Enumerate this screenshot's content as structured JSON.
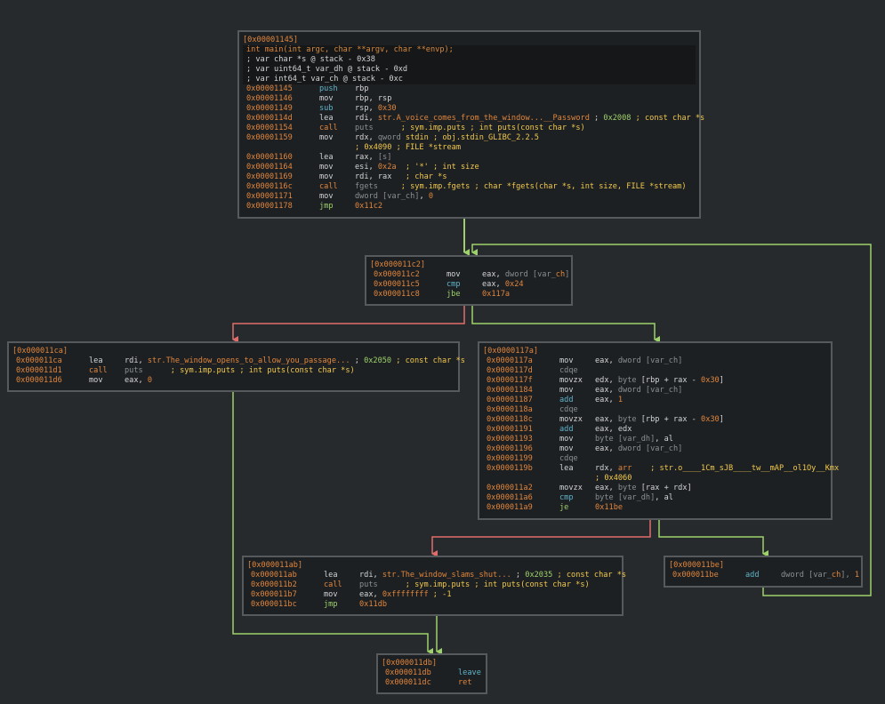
{
  "colors": {
    "background": "#262a2d",
    "node_bg": "#1d2023",
    "node_border": "#565a5d",
    "edge_true": "#9ed16b",
    "edge_false": "#e06c6c",
    "address": "#e0853c",
    "comment": "#f2c94c",
    "mnemonic_flow": "#e0853c",
    "mnemonic_cmp": "#5fb3c8"
  },
  "nodes": [
    {
      "id": "node-1145",
      "header": "[0x00001145]",
      "lines": [
        {
          "hl": true,
          "segs": [
            [
              "int ",
              "c-orange"
            ],
            [
              "main",
              "c-orange"
            ],
            [
              "(int argc, char **argv, char **envp);",
              "c-sig"
            ]
          ]
        },
        {
          "hl": true,
          "segs": [
            [
              "; var char *s @ stack - 0x38",
              "c-white"
            ]
          ]
        },
        {
          "hl": true,
          "segs": [
            [
              "; var uint64_t var_dh @ stack - 0xd",
              "c-white"
            ]
          ]
        },
        {
          "hl": true,
          "segs": [
            [
              "; var int64_t var_ch @ stack - 0xc",
              "c-white"
            ]
          ]
        },
        {
          "addr": "0x00001145",
          "mn": "push",
          "mc": "c-cyan",
          "op": [
            [
              "rbp",
              "c-white"
            ]
          ]
        },
        {
          "addr": "0x00001146",
          "mn": "mov",
          "mc": "c-white",
          "op": [
            [
              "rbp, rsp",
              "c-white"
            ]
          ]
        },
        {
          "addr": "0x00001149",
          "mn": "sub",
          "mc": "c-cyan",
          "op": [
            [
              "rsp, ",
              "c-white"
            ],
            [
              "0x30",
              "c-orange"
            ]
          ]
        },
        {
          "addr": "0x0000114d",
          "mn": "lea",
          "mc": "c-white",
          "op": [
            [
              "rdi, ",
              "c-white"
            ],
            [
              "str.A_voice_comes_from_the_window...__Password",
              "c-orange"
            ],
            [
              " ; ",
              "c-white"
            ],
            [
              "0x2008",
              "c-green"
            ],
            [
              " ; const char *s",
              "c-yellow"
            ]
          ]
        },
        {
          "addr": "0x00001154",
          "mn": "call",
          "mc": "c-orange",
          "op": [
            [
              "puts",
              "c-gray"
            ],
            [
              "      ; sym.imp.puts ; int puts(const char *s)",
              "c-yellow"
            ]
          ]
        },
        {
          "addr": "0x00001159",
          "mn": "mov",
          "mc": "c-white",
          "op": [
            [
              "rdx, ",
              "c-white"
            ],
            [
              "qword",
              "c-gray"
            ],
            [
              " stdin ; obj.stdin_GLIBC_2.2.5",
              "c-yellow"
            ]
          ]
        },
        {
          "addr": "",
          "mn": "",
          "mc": "c-white",
          "op": [
            [
              "; 0x4090 ; FILE *stream",
              "c-yellow"
            ]
          ]
        },
        {
          "addr": "0x00001160",
          "mn": "lea",
          "mc": "c-white",
          "op": [
            [
              "rax, ",
              "c-white"
            ],
            [
              "[s]",
              "c-gray"
            ]
          ]
        },
        {
          "addr": "0x00001164",
          "mn": "mov",
          "mc": "c-white",
          "op": [
            [
              "esi, ",
              "c-white"
            ],
            [
              "0x2a",
              "c-orange"
            ],
            [
              "  ; '*' ; int size",
              "c-yellow"
            ]
          ]
        },
        {
          "addr": "0x00001169",
          "mn": "mov",
          "mc": "c-white",
          "op": [
            [
              "rdi, rax",
              "c-white"
            ],
            [
              "   ; char *s",
              "c-yellow"
            ]
          ]
        },
        {
          "addr": "0x0000116c",
          "mn": "call",
          "mc": "c-orange",
          "op": [
            [
              "fgets",
              "c-gray"
            ],
            [
              "     ; sym.imp.fgets ; char *fgets(char *s, int size, FILE *stream)",
              "c-yellow"
            ]
          ]
        },
        {
          "addr": "0x00001171",
          "mn": "mov",
          "mc": "c-white",
          "op": [
            [
              "dword",
              "c-gray"
            ],
            [
              " [var_ch]",
              "c-gray"
            ],
            [
              ", ",
              "c-white"
            ],
            [
              "0",
              "c-orange"
            ]
          ]
        },
        {
          "addr": "0x00001178",
          "mn": "jmp",
          "mc": "c-green",
          "op": [
            [
              "0x11c2",
              "c-orange"
            ]
          ]
        }
      ]
    },
    {
      "id": "node-11c2",
      "header": "[0x000011c2]",
      "lines": [
        {
          "addr": "0x000011c2",
          "mn": "mov",
          "mc": "c-white",
          "op": [
            [
              "eax, ",
              "c-white"
            ],
            [
              "dword",
              "c-gray"
            ],
            [
              " [var_",
              "c-gray"
            ],
            [
              "ch",
              "c-orange"
            ],
            [
              "]",
              "c-gray"
            ]
          ]
        },
        {
          "addr": "0x000011c5",
          "mn": "cmp",
          "mc": "c-cyan",
          "op": [
            [
              "eax, ",
              "c-white"
            ],
            [
              "0x24",
              "c-orange"
            ]
          ]
        },
        {
          "addr": "0x000011c8",
          "mn": "jbe",
          "mc": "c-green",
          "op": [
            [
              "0x117a",
              "c-orange"
            ]
          ]
        }
      ]
    },
    {
      "id": "node-11ca",
      "header": "[0x000011ca]",
      "lines": [
        {
          "addr": "0x000011ca",
          "mn": "lea",
          "mc": "c-white",
          "op": [
            [
              "rdi, ",
              "c-white"
            ],
            [
              "str.The_window_opens_to_allow_you_passage...",
              "c-orange"
            ],
            [
              " ; ",
              "c-white"
            ],
            [
              "0x2050",
              "c-green"
            ],
            [
              " ; const char *s",
              "c-yellow"
            ]
          ]
        },
        {
          "addr": "0x000011d1",
          "mn": "call",
          "mc": "c-orange",
          "op": [
            [
              "puts",
              "c-gray"
            ],
            [
              "      ; sym.imp.puts ; int puts(const char *s)",
              "c-yellow"
            ]
          ]
        },
        {
          "addr": "0x000011d6",
          "mn": "mov",
          "mc": "c-white",
          "op": [
            [
              "eax, ",
              "c-white"
            ],
            [
              "0",
              "c-orange"
            ]
          ]
        }
      ]
    },
    {
      "id": "node-117a",
      "header": "[0x0000117a]",
      "lines": [
        {
          "addr": "0x0000117a",
          "mn": "mov",
          "mc": "c-white",
          "op": [
            [
              "eax, ",
              "c-white"
            ],
            [
              "dword [var_ch]",
              "c-gray"
            ]
          ]
        },
        {
          "addr": "0x0000117d",
          "mn": "cdqe",
          "mc": "c-gray",
          "op": []
        },
        {
          "addr": "0x0000117f",
          "mn": "movzx",
          "mc": "c-white",
          "op": [
            [
              "edx, ",
              "c-white"
            ],
            [
              "byte",
              "c-gray"
            ],
            [
              " [rbp + rax - ",
              "c-white"
            ],
            [
              "0x30",
              "c-orange"
            ],
            [
              "]",
              "c-white"
            ]
          ]
        },
        {
          "addr": "0x00001184",
          "mn": "mov",
          "mc": "c-white",
          "op": [
            [
              "eax, ",
              "c-white"
            ],
            [
              "dword [var_ch]",
              "c-gray"
            ]
          ]
        },
        {
          "addr": "0x00001187",
          "mn": "add",
          "mc": "c-cyan",
          "op": [
            [
              "eax, ",
              "c-white"
            ],
            [
              "1",
              "c-orange"
            ]
          ]
        },
        {
          "addr": "0x0000118a",
          "mn": "cdqe",
          "mc": "c-gray",
          "op": []
        },
        {
          "addr": "0x0000118c",
          "mn": "movzx",
          "mc": "c-white",
          "op": [
            [
              "eax, ",
              "c-white"
            ],
            [
              "byte",
              "c-gray"
            ],
            [
              " [rbp + rax - ",
              "c-white"
            ],
            [
              "0x30",
              "c-orange"
            ],
            [
              "]",
              "c-white"
            ]
          ]
        },
        {
          "addr": "0x00001191",
          "mn": "add",
          "mc": "c-cyan",
          "op": [
            [
              "eax, edx",
              "c-white"
            ]
          ]
        },
        {
          "addr": "0x00001193",
          "mn": "mov",
          "mc": "c-white",
          "op": [
            [
              "byte [var_dh]",
              "c-gray"
            ],
            [
              ", al",
              "c-white"
            ]
          ]
        },
        {
          "addr": "0x00001196",
          "mn": "mov",
          "mc": "c-white",
          "op": [
            [
              "eax, ",
              "c-white"
            ],
            [
              "dword [var_ch]",
              "c-gray"
            ]
          ]
        },
        {
          "addr": "0x00001199",
          "mn": "cdqe",
          "mc": "c-gray",
          "op": []
        },
        {
          "addr": "0x0000119b",
          "mn": "lea",
          "mc": "c-white",
          "op": [
            [
              "rdx, ",
              "c-white"
            ],
            [
              "arr",
              "c-orange"
            ],
            [
              "    ; str.o____1Cm_sJB____tw__mAP__ol1Oy__Kmx",
              "c-yellow"
            ]
          ]
        },
        {
          "addr": "",
          "mn": "",
          "mc": "c-white",
          "op": [
            [
              "; 0x4060",
              "c-yellow"
            ]
          ]
        },
        {
          "addr": "0x000011a2",
          "mn": "movzx",
          "mc": "c-white",
          "op": [
            [
              "eax, ",
              "c-white"
            ],
            [
              "byte",
              "c-gray"
            ],
            [
              " [rax + rdx]",
              "c-white"
            ]
          ]
        },
        {
          "addr": "0x000011a6",
          "mn": "cmp",
          "mc": "c-cyan",
          "op": [
            [
              "byte [var_dh]",
              "c-gray"
            ],
            [
              ", al",
              "c-white"
            ]
          ]
        },
        {
          "addr": "0x000011a9",
          "mn": "je",
          "mc": "c-green",
          "op": [
            [
              "0x11be",
              "c-orange"
            ]
          ]
        }
      ]
    },
    {
      "id": "node-11ab",
      "header": "[0x000011ab]",
      "lines": [
        {
          "addr": "0x000011ab",
          "mn": "lea",
          "mc": "c-white",
          "op": [
            [
              "rdi, ",
              "c-white"
            ],
            [
              "str.The_window_slams_shut...",
              "c-orange"
            ],
            [
              " ; ",
              "c-white"
            ],
            [
              "0x2035",
              "c-green"
            ],
            [
              " ; const char *s",
              "c-yellow"
            ]
          ]
        },
        {
          "addr": "0x000011b2",
          "mn": "call",
          "mc": "c-orange",
          "op": [
            [
              "puts",
              "c-gray"
            ],
            [
              "      ; sym.imp.puts ; int puts(const char *s)",
              "c-yellow"
            ]
          ]
        },
        {
          "addr": "0x000011b7",
          "mn": "mov",
          "mc": "c-white",
          "op": [
            [
              "eax, ",
              "c-white"
            ],
            [
              "0xffffffff",
              "c-orange"
            ],
            [
              " ; -1",
              "c-yellow"
            ]
          ]
        },
        {
          "addr": "0x000011bc",
          "mn": "jmp",
          "mc": "c-green",
          "op": [
            [
              "0x11db",
              "c-orange"
            ]
          ]
        }
      ]
    },
    {
      "id": "node-11be",
      "header": "[0x000011be]",
      "lines": [
        {
          "addr": "0x000011be",
          "mn": "add",
          "mc": "c-cyan",
          "op": [
            [
              "dword [var_",
              "c-gray"
            ],
            [
              "ch",
              "c-orange"
            ],
            [
              "], ",
              "c-gray"
            ],
            [
              "1",
              "c-orange"
            ]
          ]
        }
      ]
    },
    {
      "id": "node-11db",
      "header": "[0x000011db]",
      "lines": [
        {
          "addr": "0x000011db",
          "mn": "leave",
          "mc": "c-cyan",
          "op": []
        },
        {
          "addr": "0x000011dc",
          "mn": "ret",
          "mc": "c-orange",
          "op": []
        }
      ]
    }
  ]
}
